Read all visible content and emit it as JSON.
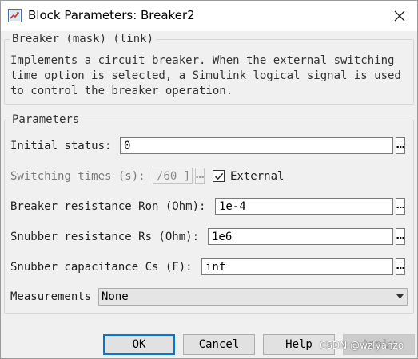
{
  "window": {
    "title": "Block Parameters: Breaker2"
  },
  "mask": {
    "title": "Breaker (mask) (link)",
    "description": "Implements a circuit breaker. When the external switching\ntime option is selected, a Simulink logical signal is used\nto control the breaker operation."
  },
  "parameters": {
    "title": "Parameters",
    "initial_status": {
      "label": "Initial status:",
      "value": "0"
    },
    "switching_times": {
      "label": "Switching times (s):",
      "value": "/60 ]"
    },
    "external": {
      "label": "External",
      "checked": true
    },
    "ron": {
      "label": "Breaker resistance Ron (Ohm):",
      "value": "1e-4"
    },
    "rs": {
      "label": "Snubber resistance Rs (Ohm):",
      "value": "1e6"
    },
    "cs": {
      "label": "Snubber capacitance Cs (F):",
      "value": "inf"
    },
    "measurements": {
      "label": "Measurements",
      "value": "None"
    }
  },
  "buttons": {
    "ok": "OK",
    "cancel": "Cancel",
    "help": "Help",
    "apply": "Apply"
  },
  "watermark": "CSDN @wzlyanzo"
}
